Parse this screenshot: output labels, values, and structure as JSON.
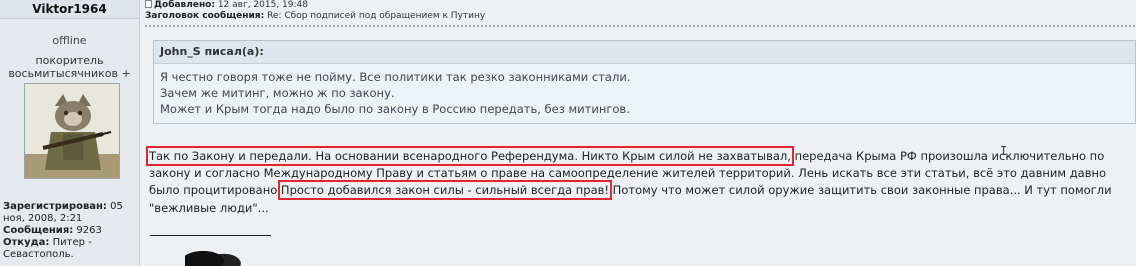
{
  "author": {
    "name": "Viktor1964",
    "status": "offline",
    "rank": "покоритель восьмитысячников +",
    "registered_label": "Зарегистрирован:",
    "registered_value": "05 ноя, 2008, 2:21",
    "posts_label": "Сообщения:",
    "posts_value": "9263",
    "location_label": "Откуда:",
    "location_value": "Питер - Севастополь."
  },
  "header": {
    "added_label": "Добавлено:",
    "added_value": "12 авг, 2015, 19:48",
    "subject_label": "Заголовок сообщения:",
    "subject_value": "Re: Сбор подписей под обращением к Путину"
  },
  "quote": {
    "head": "John_S писал(а):",
    "lines": [
      "Я честно говоря тоже не пойму. Все политики так резко законниками стали.",
      "Зачем же митинг, можно ж по закону.",
      "Может и Крым тогда надо было по закону в Россию передать, без митингов."
    ]
  },
  "post": {
    "hl1": "Так по Закону и передали. На основании всенародного Референдума. Никто Крым силой не захватывал,",
    "text1": " передача Крыма РФ произошла исключительно по закону и согласно Международному Праву и статьям о праве на самоопределение жителей территорий. Лень искать все эти статьи, всё это давним давно было процитировано ",
    "hl2": "Просто добавился закон силы - сильный всегда прав!",
    "text2": " Потому что может силой оружие защитить свои законные права... И тут помогли \"вежливые люди\"..."
  }
}
